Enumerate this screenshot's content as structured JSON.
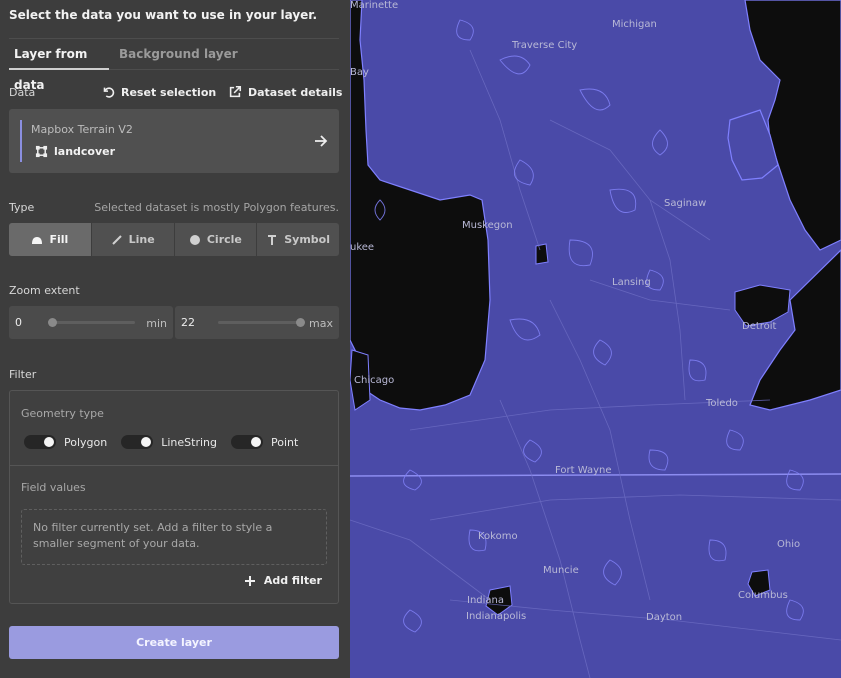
{
  "panel": {
    "heading": "Select the data you want to use in your layer.",
    "tabs": {
      "active": "Layer from data",
      "inactive": "Background layer"
    },
    "data_label": "Data",
    "reset_selection": "Reset selection",
    "dataset_details": "Dataset details",
    "source": {
      "provider": "Mapbox Terrain V2",
      "layer": "landcover"
    },
    "type_label": "Type",
    "type_hint": "Selected dataset is mostly Polygon features.",
    "types": [
      "Fill",
      "Line",
      "Circle",
      "Symbol"
    ],
    "selected_type": "Fill",
    "zoom_label": "Zoom extent",
    "zoom": {
      "min_value": "0",
      "min_unit": "min",
      "max_value": "22",
      "max_unit": "max"
    },
    "filter_label": "Filter",
    "geometry_type_label": "Geometry type",
    "geometry_types": [
      "Polygon",
      "LineString",
      "Point"
    ],
    "field_values_label": "Field values",
    "empty_filter_text": "No filter currently set. Add a filter to style a smaller segment of your data.",
    "add_filter": "Add filter",
    "create_layer": "Create layer"
  },
  "map": {
    "labels": {
      "marinette": "Marinette",
      "michigan": "Michigan",
      "traverse_city": "Traverse City",
      "bay": "Bay",
      "saginaw": "Saginaw",
      "muskegon": "Muskegon",
      "milwaukee": "ukee",
      "lansing": "Lansing",
      "detroit": "Detroit",
      "chicago": "Chicago",
      "toledo": "Toledo",
      "fort_wayne": "Fort Wayne",
      "kokomo": "Kokomo",
      "ohio": "Ohio",
      "muncie": "Muncie",
      "columbus": "Columbus",
      "indiana": "Indiana",
      "indianapolis": "Indianapolis",
      "dayton": "Dayton"
    },
    "colors": {
      "land": "#4a4aa8",
      "water": "#0d0d0d",
      "outline": "#7f80ff"
    }
  }
}
